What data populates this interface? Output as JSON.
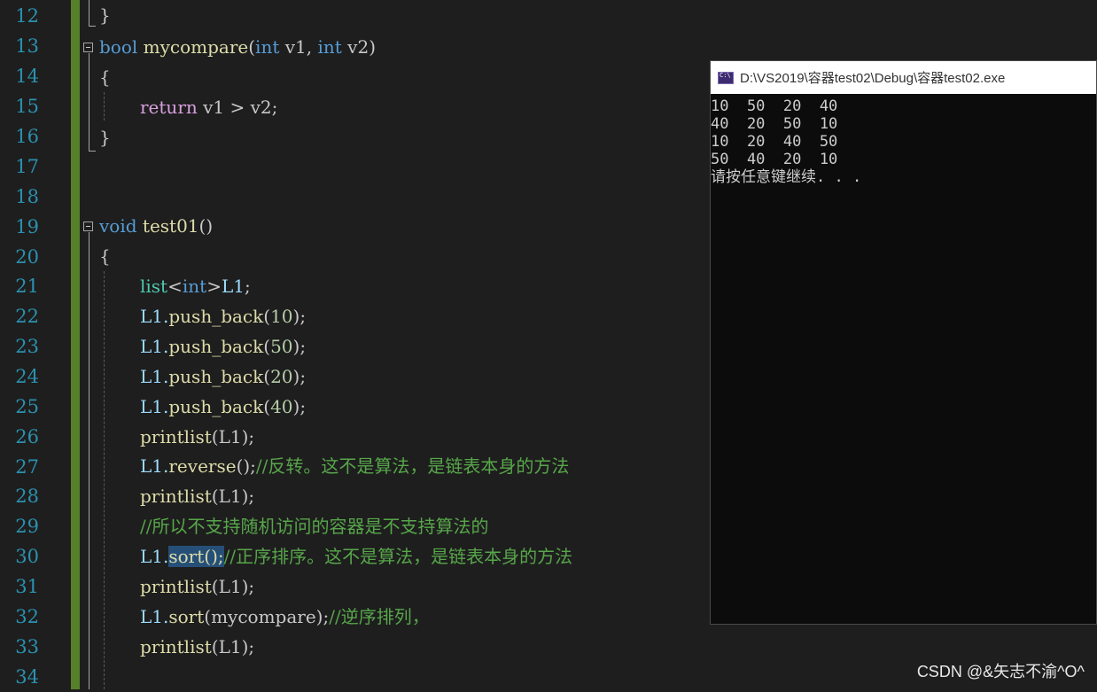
{
  "editor": {
    "line_numbers": [
      "12",
      "13",
      "14",
      "15",
      "16",
      "17",
      "18",
      "19",
      "20",
      "21",
      "22",
      "23",
      "24",
      "25",
      "26",
      "27",
      "28",
      "29",
      "30",
      "31",
      "32",
      "33",
      "34"
    ]
  },
  "code": {
    "l12_brace": "}",
    "l13_kw_bool": "bool",
    "l13_fn": "mycompare",
    "l13_open": "(",
    "l13_kw_int1": "int",
    "l13_p1": " v1, ",
    "l13_kw_int2": "int",
    "l13_p2": " v2",
    "l13_close": ")",
    "l14_brace": "{",
    "l15_kw_return": "return",
    "l15_rest": " v1 > v2;",
    "l16_brace": "}",
    "l19_kw_void": "void",
    "l19_fn": "test01",
    "l19_parens": "()",
    "l20_brace": "{",
    "l21_list": "list",
    "l21_lt": "<",
    "l21_int": "int",
    "l21_gt": ">",
    "l21_var": "L1",
    "l21_semi": ";",
    "l22_obj": "L1.",
    "l22_fn": "push_back",
    "l22_open": "(",
    "l22_num": "10",
    "l22_close": ");",
    "l23_obj": "L1.",
    "l23_fn": "push_back",
    "l23_open": "(",
    "l23_num": "50",
    "l23_close": ");",
    "l24_obj": "L1.",
    "l24_fn": "push_back",
    "l24_open": "(",
    "l24_num": "20",
    "l24_close": ");",
    "l25_obj": "L1.",
    "l25_fn": "push_back",
    "l25_open": "(",
    "l25_num": "40",
    "l25_close": ");",
    "l26_fn": "printlist",
    "l26_args": "(L1);",
    "l27_obj": "L1.",
    "l27_fn": "reverse",
    "l27_call": "();",
    "l27_comment": "//反转。这不是算法，是链表本身的方法",
    "l28_fn": "printlist",
    "l28_args": "(L1);",
    "l29_comment": "//所以不支持随机访问的容器是不支持算法的",
    "l30_obj": "L1.",
    "l30_sel": "sort();",
    "l30_comment": "//正序排序。这不是算法，是链表本身的方法",
    "l31_fn": "printlist",
    "l31_args": "(L1);",
    "l32_obj": "L1.",
    "l32_fn": "sort",
    "l32_args": "(mycompare);",
    "l32_comment": "//逆序排列，",
    "l33_fn": "printlist",
    "l33_args": "(L1);"
  },
  "console": {
    "title": "D:\\VS2019\\容器test02\\Debug\\容器test02.exe",
    "lines": [
      "10  50  20  40",
      "40  20  50  10",
      "10  20  40  50",
      "50  40  20  10",
      "请按任意键继续. . ."
    ]
  },
  "watermark": "CSDN @&矢志不渝^O^",
  "colors": {
    "background": "#1e1e1e",
    "line_number": "#2b91af",
    "keyword": "#569cd6",
    "function": "#dcdcaa",
    "comment": "#57a64a",
    "change_bar": "#57802b",
    "selection": "#264f78"
  }
}
